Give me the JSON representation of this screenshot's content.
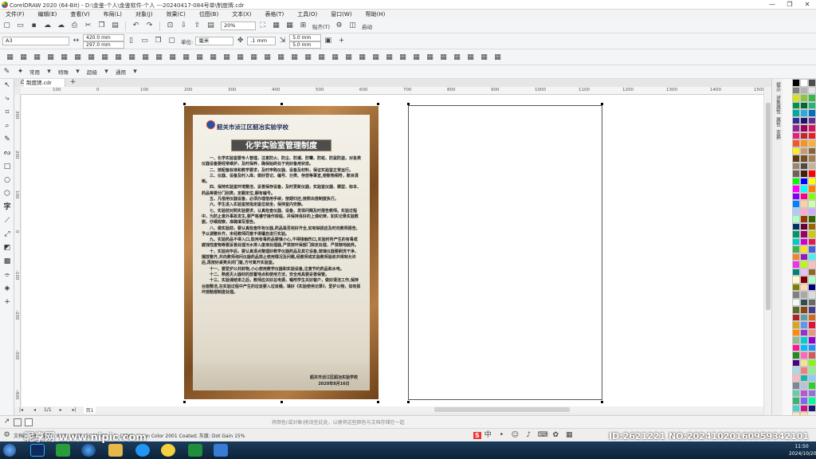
{
  "window": {
    "title": "CorelDRAW 2020 (64-Bit) - D:\\金鉴-个人\\金鉴软件-个人 ---20240417-084号单\\制度牌.cdr",
    "minimize": "—",
    "maximize": "❐",
    "close": "✕"
  },
  "menu": [
    "文件(F)",
    "编辑(E)",
    "查看(V)",
    "布局(L)",
    "对象(J)",
    "效果(C)",
    "位图(B)",
    "文本(X)",
    "表格(T)",
    "工具(O)",
    "窗口(W)",
    "帮助(H)"
  ],
  "standard_toolbar": {
    "zoom": "20%",
    "paste_label": "贴齐(T)",
    "launch_label": "启动"
  },
  "property_bar": {
    "page_size": "A3",
    "width": "420.0 mm",
    "height": "297.0 mm",
    "unit_label": "单位:",
    "unit": "毫米",
    "nudge": ".1 mm",
    "dup_x": "5.0 mm",
    "dup_y": "5.0 mm"
  },
  "format_bar": {
    "items": [
      "常用",
      "特殊",
      "超级",
      "通用"
    ]
  },
  "document": {
    "tab": "制度牌.cdr",
    "page_tab": "页1"
  },
  "ruler": {
    "h_ticks": [
      "100",
      "0",
      "100",
      "200",
      "300",
      "400",
      "500",
      "600",
      "700",
      "800",
      "900",
      "1000",
      "1100",
      "1200",
      "1300",
      "1400",
      "1500"
    ],
    "v_ticks": [
      "300",
      "200",
      "100",
      "0",
      "-100",
      "-200",
      "-300",
      "-400"
    ]
  },
  "poster": {
    "school": "韶关市浈江区韶冶实验学校",
    "title": "化学实验室管理制度",
    "rules": [
      "一、化学实验室要专人管理，注意防火、防尘、防潮、防霉、防蛀、防鼠防盗，对各类仪器设备要经常维护，及时保养，确保始终处于完好备用状态。",
      "二、按配备标准和教学要求，及时申购仪器、设备及材料，保证实验室正常运行。",
      "三、仪器、设备及时入库，做好登记、编号、分类、存放等事宜,使账物相符，账目清晰。",
      "四、保持实验室环境整洁、妥善保存设备，及时更新仪器，实验室仪器、模型、标本、药品等要分门别类，定橱定位,橱有编号。",
      "五、凡借用仪器设备，必须办理借用手续，按期归还,按照出借制度执行。",
      "六、学生进入实验室按指定座位就坐，保持室内安静。",
      "七、实验前对照实验要求，认真检查仪器、设备，发现问题及时报告教师。实验过程中，为防止意外事故发生,要严格遵守操作规程，并保持良好的上课纪律，如实记录实验数据，仔细观察，准确填写报告。",
      "八、做实验前，要认真检查所有仪器,药品是否完好齐全,如有缺损应及时向教师报告,予以调整补齐，未经教师同意不得擅自进行实验。",
      "九、实验药品不得入口,取用有毒药品要慎小心,不得接触伤口,实验时所产生的有毒或腐蚀性废物等要妥善处理污水排入废液处理器,严禁按环保部门规定处理，严禁随地抛弃。",
      "十、实验完毕后，要认真清点整理好教学仪器药品及其它设备,玻璃仪器要刷洗干净，摆放整齐,并向教师询问仪器药品禁止使用情况及问题,经教师或实验教师验收并得到允许后,再按好桌凳关闭门窗,方可离开实验室。",
      "十一、要爱护公共财物,小心使用教学仪器和实验设备,注意节约药品和水电。",
      "十二、熟悉灭火器材的放置地点和使用方法，安全用具要妥善保管。",
      "十三、实验课结束之后，教师应关好总电源，嘱咐学生关好窗户，做好清洁工作,保持台面整洁,在实验过程中产生的垃圾要入垃圾桶，填好《实验使用记录》，爱护公物，如有损坏按赔偿制度处理。"
    ],
    "sign_org": "韶关市浈江区韶冶实验学校",
    "sign_date": "2020年8月16日"
  },
  "status": {
    "hint": "将颜色(或对象)拖动至此处，以便将这些颜色与文档存储在一起",
    "color_profile": "文档颜色预置文件：RGB: sRGB IEC61966-2.1; CMYK: Japan Color 2001 Coated; 灰度: Dot Gain 15%"
  },
  "taskbar": {
    "time": "11:50",
    "date": "2024/10/20"
  },
  "watermark": {
    "left": "昵享网 www.nipic.com",
    "right": "ID:2621221 NO:20241020160959342101"
  },
  "colors": {
    "wood": "#8a5a2b",
    "title_bg": "#4d4d4d",
    "taskbar": "#0c2238",
    "palette": [
      "#000000",
      "#ffffff",
      "#4d4d4d",
      "#7f7f7f",
      "#b3b3b3",
      "#e5e5e5",
      "#d9e021",
      "#8cc63f",
      "#39b54a",
      "#009245",
      "#006837",
      "#22b573",
      "#00a99d",
      "#29abe2",
      "#0071bc",
      "#2e3192",
      "#1b1464",
      "#662d91",
      "#93278f",
      "#9e005d",
      "#d4145a",
      "#ed1e79",
      "#c1272d",
      "#ed1c24",
      "#f15a24",
      "#f7931e",
      "#fbb03b",
      "#fcee21",
      "#c69c6d",
      "#8c6239",
      "#603813",
      "#754c24",
      "#a67c52",
      "#998675",
      "#534741",
      "#c7b299",
      "#736357",
      "#42210b",
      "#ff0000",
      "#00ff00",
      "#0000ff",
      "#ffff00",
      "#ff00ff",
      "#00ffff",
      "#ff7f00",
      "#7f00ff",
      "#ff007f",
      "#7fff00",
      "#007fff",
      "#ffccaa",
      "#ccffaa",
      "#aaccff",
      "#ffaacc",
      "#ccaaff",
      "#aaffcc",
      "#993300",
      "#336600",
      "#003366",
      "#660033",
      "#996600",
      "#009966",
      "#990066",
      "#cccc00",
      "#00cccc",
      "#cc00cc",
      "#e6194b",
      "#3cb44b",
      "#ffe119",
      "#4363d8",
      "#f58231",
      "#911eb4",
      "#46f0f0",
      "#f032e6",
      "#bcf60c",
      "#fabebe",
      "#008080",
      "#e6beff",
      "#9a6324",
      "#fffac8",
      "#800000",
      "#aaffc3",
      "#808000",
      "#ffd8b1",
      "#000075",
      "#808080",
      "#a9a9a9",
      "#dcdcdc",
      "#f5f5f5",
      "#2f4f4f",
      "#696969",
      "#556b2f",
      "#8b4513",
      "#483d8b",
      "#b22222",
      "#5f9ea0",
      "#d2691e",
      "#daa520",
      "#6495ed",
      "#dc143c",
      "#ff8c00",
      "#9932cc",
      "#e9967a",
      "#8fbc8f",
      "#00ced1",
      "#9400d3",
      "#ff1493",
      "#00bfff",
      "#1e90ff",
      "#228b22",
      "#ff69b4",
      "#cd5c5c",
      "#4b0082",
      "#f0e68c",
      "#7cfc00",
      "#add8e6",
      "#f08080",
      "#90ee90",
      "#ffb6c1",
      "#20b2aa",
      "#87cefa",
      "#778899",
      "#b0c4de",
      "#32cd32",
      "#66cdaa",
      "#ba55d3",
      "#9370db",
      "#3cb371",
      "#7b68ee",
      "#00fa9a",
      "#48d1cc",
      "#c71585",
      "#191970",
      "#ffe4b5",
      "#ffdead"
    ]
  }
}
